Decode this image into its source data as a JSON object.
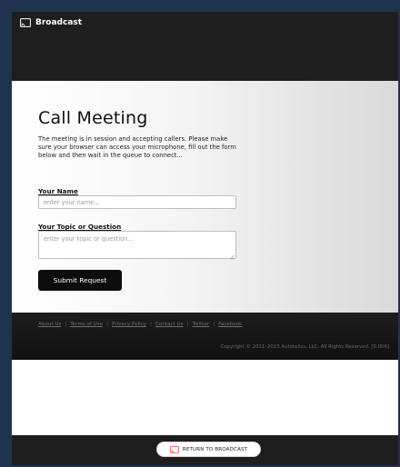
{
  "header": {
    "brand": "Broadcast"
  },
  "form": {
    "title": "Call Meeting",
    "intro": "The meeting is in session and accepting callers. Please make sure your browser can access your microphone, fill out the form below and then wait in the queue to connect...",
    "name_label": "Your Name",
    "name_placeholder": "enter your name...",
    "name_value": "",
    "topic_label": "Your Topic or Question",
    "topic_placeholder": "enter your topic or question...",
    "topic_value": "",
    "submit_label": "Submit Request"
  },
  "footer": {
    "links": [
      "About Us",
      "Terms of Use",
      "Privacy Policy",
      "Contact Us",
      "Twitter",
      "Facebook"
    ],
    "separator": "|",
    "copyright": "Copyright © 2011–2023 Autotelics, LLC. All Rights Reserved. [0.006]"
  },
  "bottom_bar": {
    "return_label": "RETURN TO BROADCAST"
  },
  "icons": {
    "brand": "cast-icon",
    "return": "cast-icon"
  },
  "colors": {
    "topbar": "#1e1e1e",
    "submit": "#0d0d0d",
    "return_icon": "#e24a2e"
  }
}
